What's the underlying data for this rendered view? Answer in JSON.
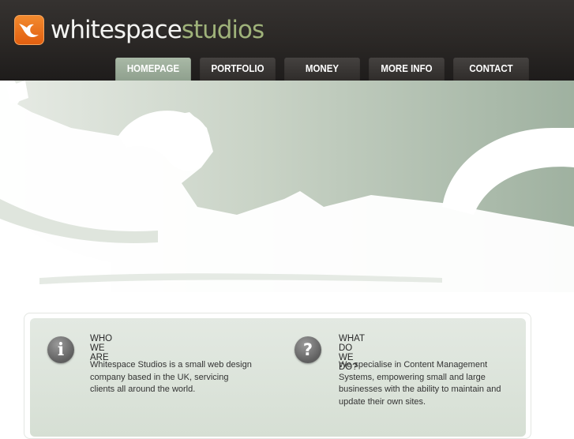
{
  "brand": {
    "name_primary": "whitespace",
    "name_secondary": "studios",
    "primary_color": "#f4f4f2",
    "secondary_color": "#9fb27a",
    "icon": "bird-logo-icon",
    "icon_color": "#ee7a22"
  },
  "nav": {
    "items": [
      {
        "label": "HOMEPAGE",
        "active": true
      },
      {
        "label": "PORTFOLIO",
        "active": false
      },
      {
        "label": "MONEY",
        "active": false
      },
      {
        "label": "MORE INFO",
        "active": false
      },
      {
        "label": "CONTACT",
        "active": false
      }
    ],
    "active_color": "#9aab98",
    "tab_color": "#3c3937"
  },
  "hero": {
    "image": "silhouette of woman lying on motorcycle",
    "tint": "#b7c4b4"
  },
  "sections": [
    {
      "icon": "info-icon",
      "icon_glyph": "i",
      "title": "WHO WE ARE",
      "lines": [
        "Whitespace Studios is a small web design",
        "company based in the UK, servicing",
        "clients all around the world."
      ]
    },
    {
      "icon": "question-icon",
      "icon_glyph": "?",
      "title": "WHAT DO WE DO?",
      "lines": [
        "We specialise in Content Management",
        "Systems, empowering small and large",
        "businesses with the ability to maintain and",
        "update their own sites."
      ]
    }
  ]
}
